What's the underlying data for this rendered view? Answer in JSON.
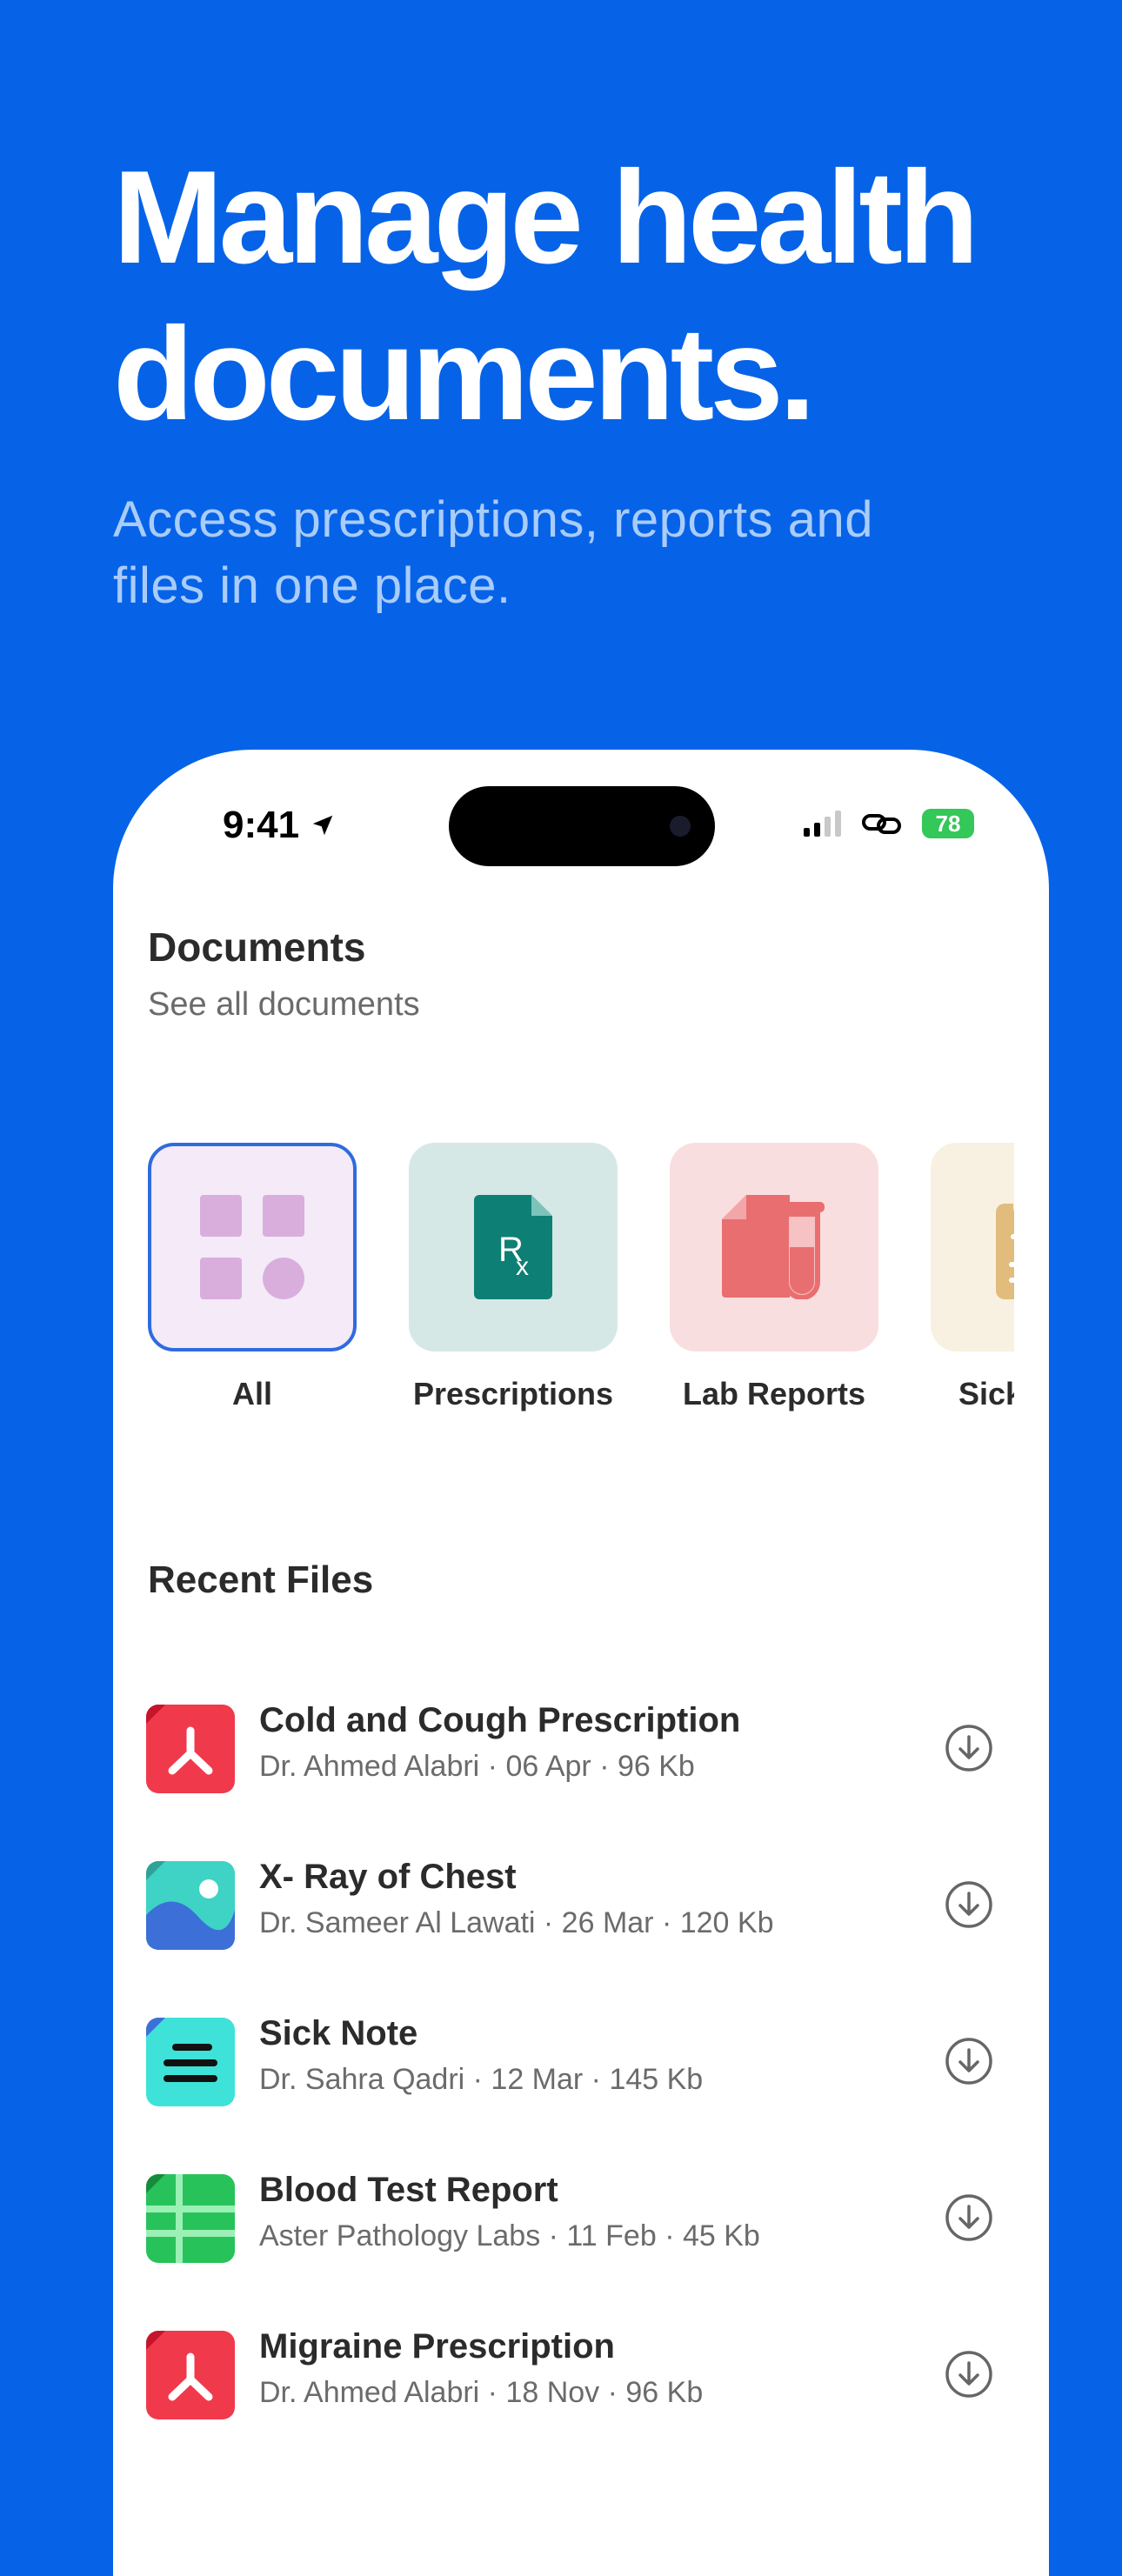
{
  "hero": {
    "title_line1": "Manage health",
    "title_line2": "documents.",
    "subtitle_line1": "Access prescriptions, reports and",
    "subtitle_line2": "files in one place."
  },
  "status_bar": {
    "time": "9:41",
    "battery": "78"
  },
  "documents": {
    "title": "Documents",
    "subtitle": "See all documents",
    "categories": [
      {
        "label": "All",
        "icon": "grid-icon",
        "selected": true
      },
      {
        "label": "Prescriptions",
        "icon": "prescription-icon"
      },
      {
        "label": "Lab Reports",
        "icon": "lab-report-icon"
      },
      {
        "label": "Sick",
        "icon": "clipboard-icon"
      }
    ]
  },
  "recent": {
    "title": "Recent Files",
    "files": [
      {
        "name": "Cold and Cough Prescription",
        "meta": "Dr. Ahmed Alabri · 06 Apr · 96 Kb",
        "icon": "pdf-icon"
      },
      {
        "name": "X- Ray of Chest",
        "meta": "Dr. Sameer Al Lawati · 26 Mar · 120 Kb",
        "icon": "image-icon"
      },
      {
        "name": "Sick Note",
        "meta": "Dr. Sahra Qadri · 12 Mar · 145 Kb",
        "icon": "note-icon"
      },
      {
        "name": "Blood Test Report",
        "meta": "Aster Pathology Labs · 11 Feb · 45 Kb",
        "icon": "spreadsheet-icon"
      },
      {
        "name": "Migraine Prescription",
        "meta": "Dr. Ahmed Alabri · 18 Nov · 96 Kb",
        "icon": "pdf-icon"
      }
    ]
  },
  "colors": {
    "background": "#0663E8",
    "selected_border": "#2F6BDE"
  }
}
